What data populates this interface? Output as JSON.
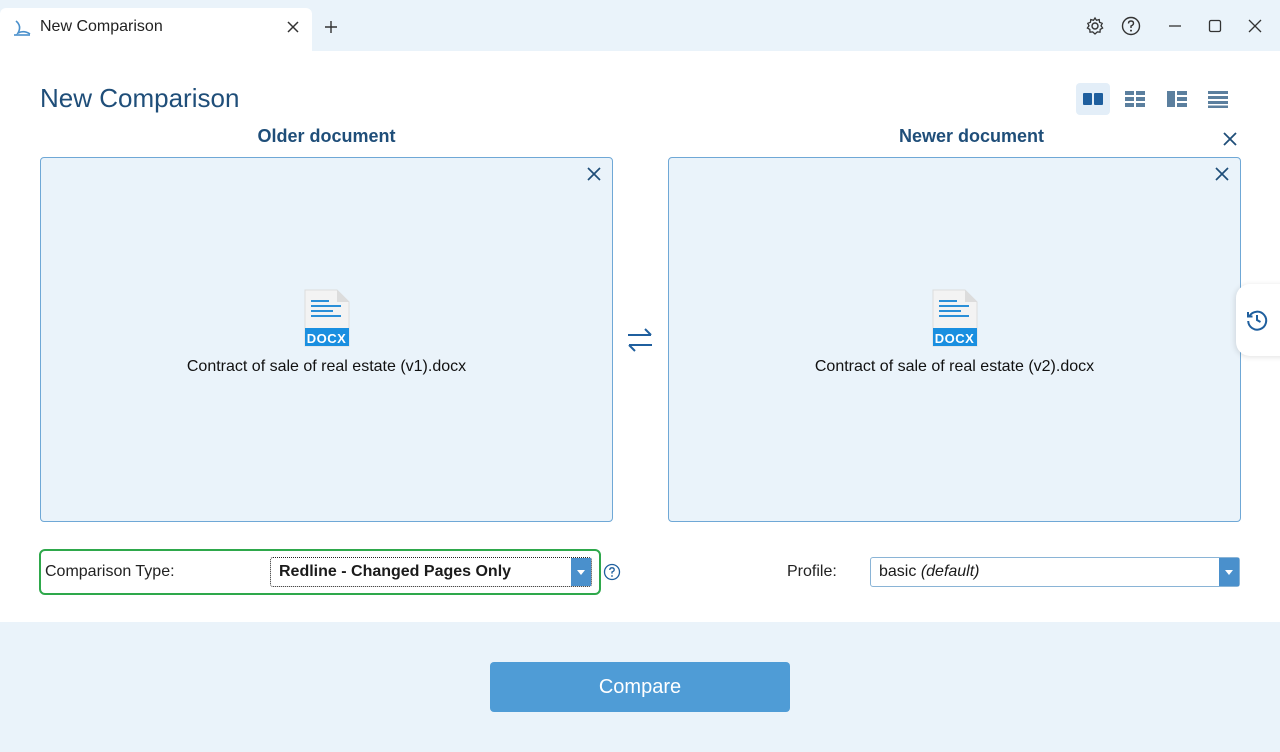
{
  "window": {
    "tab_label": "New Comparison",
    "icons": [
      "app-logo-icon",
      "close-icon",
      "plus-icon",
      "gear-icon",
      "help-icon",
      "minimize-icon",
      "maximize-icon",
      "close-icon"
    ]
  },
  "header": {
    "title": "New Comparison",
    "view_modes": [
      "side-by-side",
      "grid",
      "split",
      "list"
    ],
    "active_view": "side-by-side"
  },
  "older": {
    "title": "Older document",
    "badge": "DOCX",
    "file_name": "Contract of sale of real estate (v1).docx"
  },
  "newer": {
    "title": "Newer document",
    "badge": "DOCX",
    "file_name": "Contract of sale of real estate (v2).docx"
  },
  "options": {
    "comparison_type_label": "Comparison Type:",
    "comparison_type_value": "Redline - Changed Pages Only",
    "profile_label": "Profile:",
    "profile_value": "basic",
    "profile_suffix": "(default)"
  },
  "actions": {
    "compare_label": "Compare"
  },
  "colors": {
    "accent": "#4f9cd6",
    "title": "#1f4e79",
    "highlight": "#2ea84b",
    "panel": "#eaf3fa"
  }
}
